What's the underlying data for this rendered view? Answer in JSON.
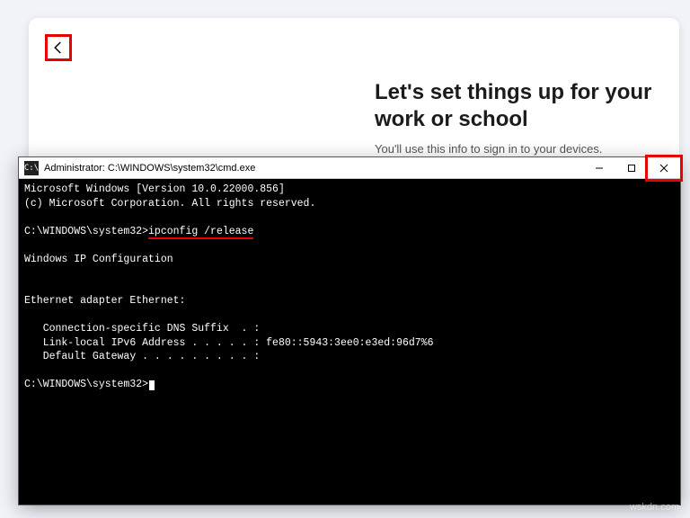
{
  "oobe": {
    "heading": "Let's set things up for your work or school",
    "subtitle": "You'll use this info to sign in to your devices."
  },
  "cmd": {
    "title": "Administrator: C:\\WINDOWS\\system32\\cmd.exe",
    "icon_label": "C:\\",
    "lines": {
      "ver": "Microsoft Windows [Version 10.0.22000.856]",
      "copy": "(c) Microsoft Corporation. All rights reserved.",
      "prompt1_path": "C:\\WINDOWS\\system32>",
      "prompt1_cmd": "ipconfig /release",
      "ipconf": "Windows IP Configuration",
      "adapter": "Ethernet adapter Ethernet:",
      "dns": "   Connection-specific DNS Suffix  . :",
      "ipv6": "   Link-local IPv6 Address . . . . . : fe80::5943:3ee0:e3ed:96d7%6",
      "gw": "   Default Gateway . . . . . . . . . :",
      "prompt2": "C:\\WINDOWS\\system32>"
    }
  },
  "highlight_colors": {
    "annotation": "#e70000"
  },
  "watermark": "wskdn.com"
}
